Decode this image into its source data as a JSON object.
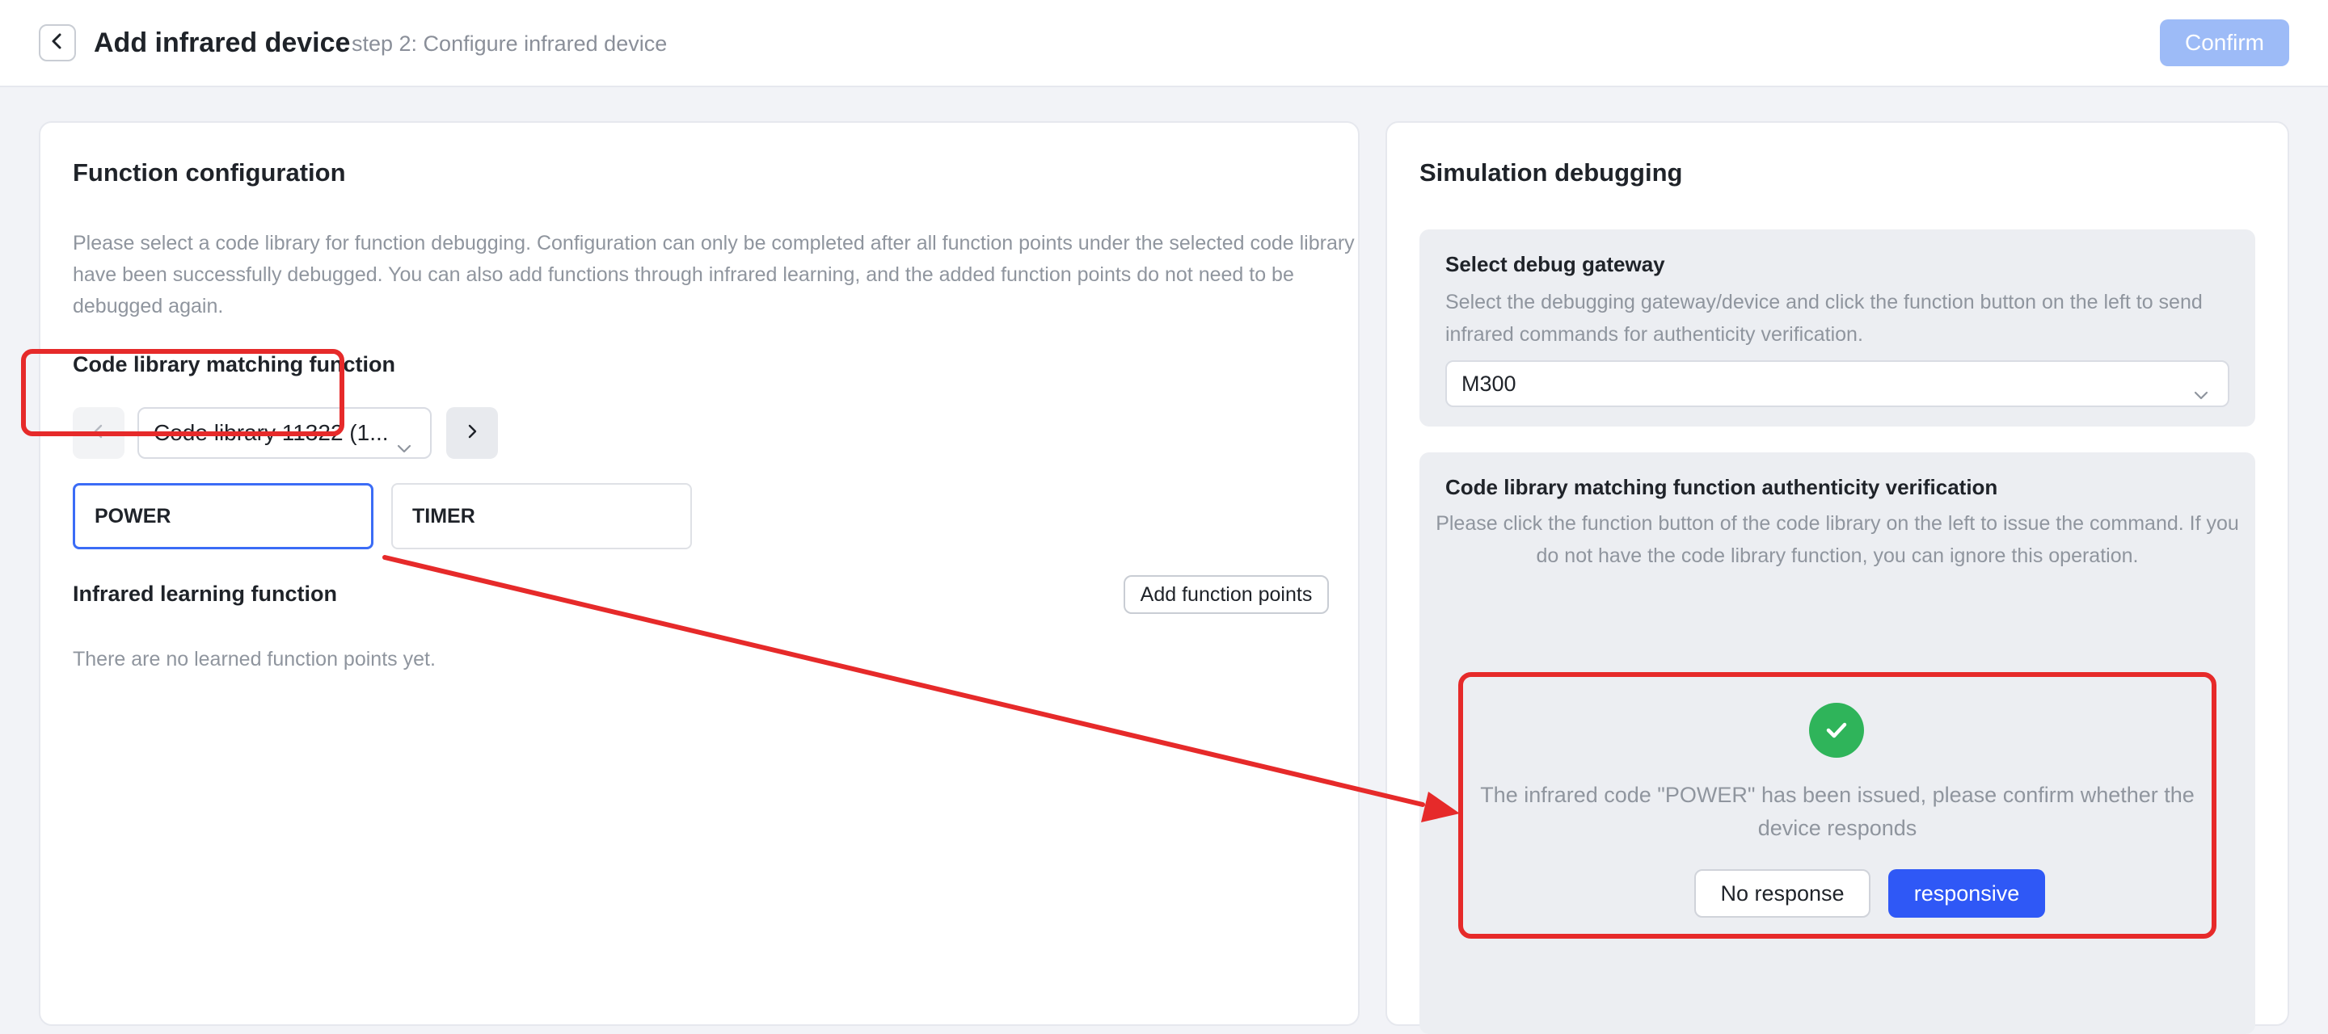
{
  "header": {
    "title": "Add infrared device",
    "subtitle": "step 2: Configure infrared device",
    "confirm_label": "Confirm"
  },
  "function_config": {
    "title": "Function configuration",
    "description": "Please select a code library for function debugging. Configuration can only be completed after all function points under the selected code library have been successfully debugged. You can also add functions through infrared learning, and the added function points do not need to be debugged again.",
    "code_library_section": "Code library matching function",
    "code_library_selected": "Code library 11322 (1...",
    "functions": [
      {
        "label": "POWER"
      },
      {
        "label": "TIMER"
      }
    ],
    "learning_section": "Infrared learning function",
    "add_function_label": "Add function points",
    "empty_text": "There are no learned function points yet."
  },
  "simulation": {
    "title": "Simulation debugging",
    "gateway": {
      "title": "Select debug gateway",
      "description": "Select the debugging gateway/device and click the function button on the left to send infrared commands for authenticity verification.",
      "selected": "M300"
    },
    "verification": {
      "title": "Code library matching function authenticity verification",
      "description": "Please click the function button of the code library on the left to issue the command. If you do not have the code library function, you can ignore this operation.",
      "issued_message": "The infrared code \"POWER\" has been issued, please confirm whether the device responds",
      "no_response_label": "No response",
      "responsive_label": "responsive"
    }
  },
  "colors": {
    "primary": "#2f58f6",
    "primary_disabled": "#9dbbf7",
    "success": "#2fb45a",
    "annotation": "#e62a2a",
    "selected_border": "#3b6cf6"
  }
}
